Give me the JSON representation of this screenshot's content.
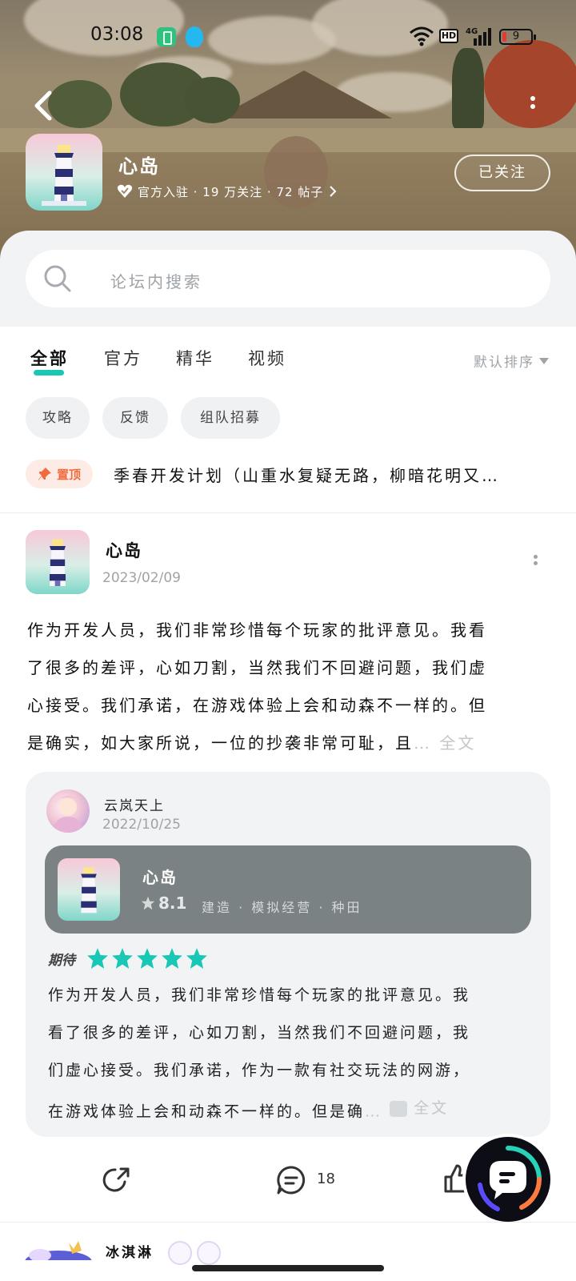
{
  "status_bar": {
    "time": "03:08",
    "network": "4G",
    "hd": "HD",
    "battery_level": "9"
  },
  "forum": {
    "name": "心岛",
    "meta": "官方入驻 · 19 万关注 · 72 帖子",
    "follow_label": "已关注"
  },
  "search": {
    "placeholder": "论坛内搜索"
  },
  "tabs": [
    {
      "label": "全部",
      "active": true
    },
    {
      "label": "官方",
      "active": false
    },
    {
      "label": "精华",
      "active": false
    },
    {
      "label": "视频",
      "active": false
    }
  ],
  "sort_label": "默认排序",
  "chips": [
    "攻略",
    "反馈",
    "组队招募"
  ],
  "pinned": {
    "badge": "置顶",
    "title": "季春开发计划（山重水复疑无路，柳暗花明又…"
  },
  "post": {
    "author": "心岛",
    "date": "2023/02/09",
    "lines": [
      "作为开发人员，我们非常珍惜每个玩家的批评意见。我看",
      "了很多的差评，心如刀割，当然我们不回避问题，我们虚",
      "心接受。我们承诺，在游戏体验上会和动森不一样的。但",
      "是确实，如大家所说，一位的抄袭非常可耻，且"
    ],
    "ellipsis": "…",
    "full_text_label": "全文"
  },
  "quote": {
    "author": "云岚天上",
    "date": "2022/10/25",
    "game": {
      "name": "心岛",
      "score": "8.1",
      "tags": "建造 · 模拟经营 · 种田"
    },
    "rating_label": "期待",
    "rating_stars": 5,
    "lines": [
      "作为开发人员，我们非常珍惜每个玩家的批评意见。我",
      "看了很多的差评，心如刀割，当然我们不回避问题，我",
      "们虚心接受。我们承诺，作为一款有社交玩法的网游，",
      "在游戏体验上会和动森不一样的。但是确"
    ],
    "ellipsis": "…",
    "full_text_label": "全文"
  },
  "actions": {
    "comment_count": "18"
  },
  "next_post": {
    "author": "冰淇淋"
  },
  "colors": {
    "accent": "#19c8b4",
    "star": "#19c8b4",
    "pin": "#f26a3d"
  }
}
